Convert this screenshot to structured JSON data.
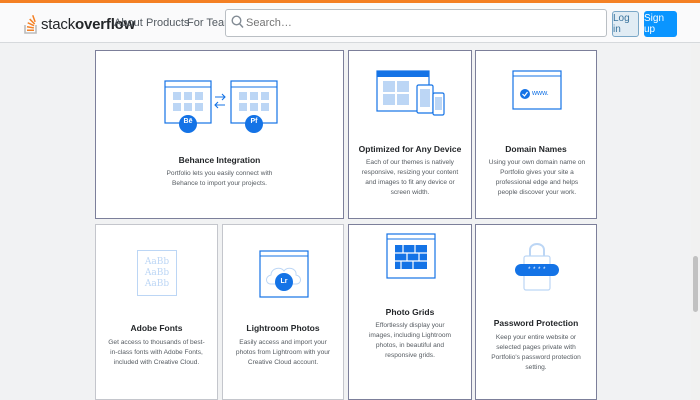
{
  "header": {
    "logo_prefix": "stack",
    "logo_bold": "overflow",
    "nav": [
      "About",
      "Products",
      "For Teams"
    ],
    "search_placeholder": "Search…",
    "login_label": "Log in",
    "signup_label": "Sign up"
  },
  "colors": {
    "brand_orange": "#f48024",
    "accent_blue": "#0a95ff",
    "icon_blue": "#1473e6"
  },
  "features": {
    "behance": {
      "title": "Behance Integration",
      "desc": "Portfolio lets you easily connect with Behance to import your projects.",
      "badge_left": "Bē",
      "badge_right": "Pf"
    },
    "devices": {
      "title": "Optimized for Any Device",
      "desc": "Each of our themes is natively responsive, resizing your content and images to fit any device or screen width."
    },
    "domain": {
      "title": "Domain Names",
      "desc": "Using your own domain name on Portfolio gives your site a professional edge and helps people discover your work.",
      "url": "www."
    },
    "fonts": {
      "title": "Adobe Fonts",
      "desc": "Get access to thousands of best-in-class fonts with Adobe Fonts, included with Creative Cloud.",
      "sample": "AaBb"
    },
    "lightroom": {
      "title": "Lightroom Photos",
      "desc": "Easily access and import your photos from Lightroom with your Creative Cloud account.",
      "badge": "Lr"
    },
    "grids": {
      "title": "Photo Grids",
      "desc": "Effortlessly display your images, including Lightroom photos, in beautiful and responsive grids."
    },
    "password": {
      "title": "Password Protection",
      "desc": "Keep your entire website or selected pages private with Portfolio's password protection setting.",
      "mask": "* * * *"
    }
  }
}
